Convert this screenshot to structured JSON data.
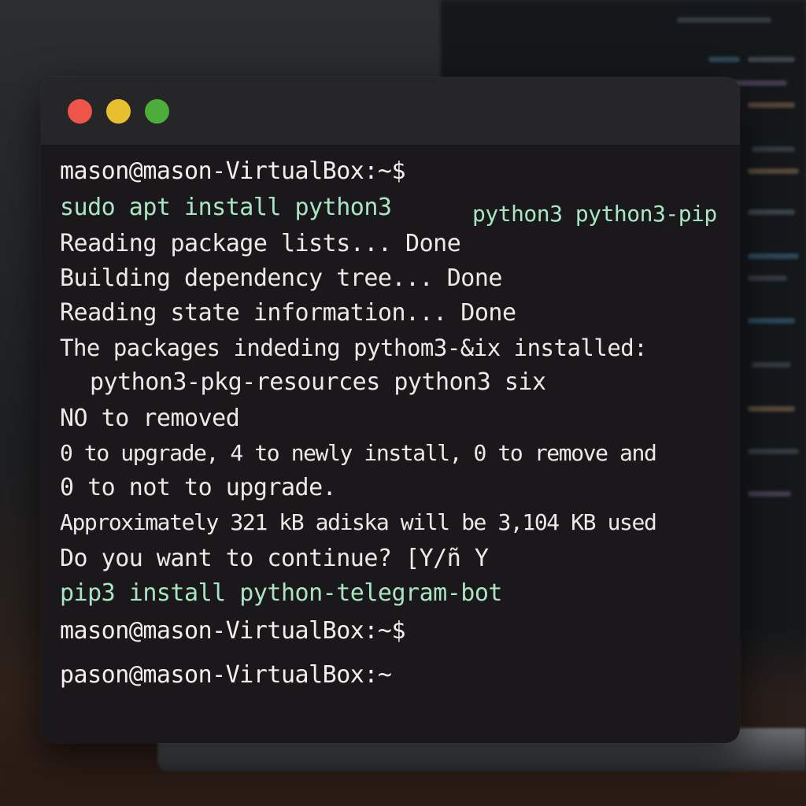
{
  "colors": {
    "terminal_bg": "#1b181c",
    "titlebar_bg": "#262528",
    "close_dot": "#ee5447",
    "minimize_dot": "#e7c12d",
    "maximize_dot": "#4cad3b",
    "command_text": "#a8e6c3",
    "output_text": "#eceae6"
  },
  "window_controls": {
    "close_icon": "close-dot-icon",
    "minimize_icon": "minimize-dot-icon",
    "maximize_icon": "maximize-dot-icon"
  },
  "terminal": {
    "lines": [
      {
        "type": "prompt",
        "text": "mason@mason-VirtualBox:~$"
      },
      {
        "type": "command",
        "text": "sudo apt install python3"
      },
      {
        "type": "command",
        "text": "python3 python3-pip"
      },
      {
        "type": "output",
        "text": "Reading package lists... Done"
      },
      {
        "type": "output",
        "text": "Building dependency tree... Done"
      },
      {
        "type": "output",
        "text": "Reading state information... Done"
      },
      {
        "type": "output",
        "text": "The packages indeding pythom3-&ix installed:"
      },
      {
        "type": "output",
        "text": "python3-pkg-resources python3 six"
      },
      {
        "type": "output",
        "text": "NO to removed"
      },
      {
        "type": "output",
        "text": "0 to upgrade, 4 to newly install, 0 to remove and"
      },
      {
        "type": "output",
        "text": "0 to not to upgrade."
      },
      {
        "type": "output",
        "text": "Approximately 321 kB adiska will be 3,104 KB used"
      },
      {
        "type": "output",
        "text": "Do you want to continue? [Y/ñ Y"
      },
      {
        "type": "command",
        "text": "pip3 install python-telegram-bot"
      },
      {
        "type": "prompt",
        "text": "mason@mason-VirtualBox:~$"
      },
      {
        "type": "prompt",
        "text": "pason@mason-VirtualBox:~"
      }
    ]
  }
}
